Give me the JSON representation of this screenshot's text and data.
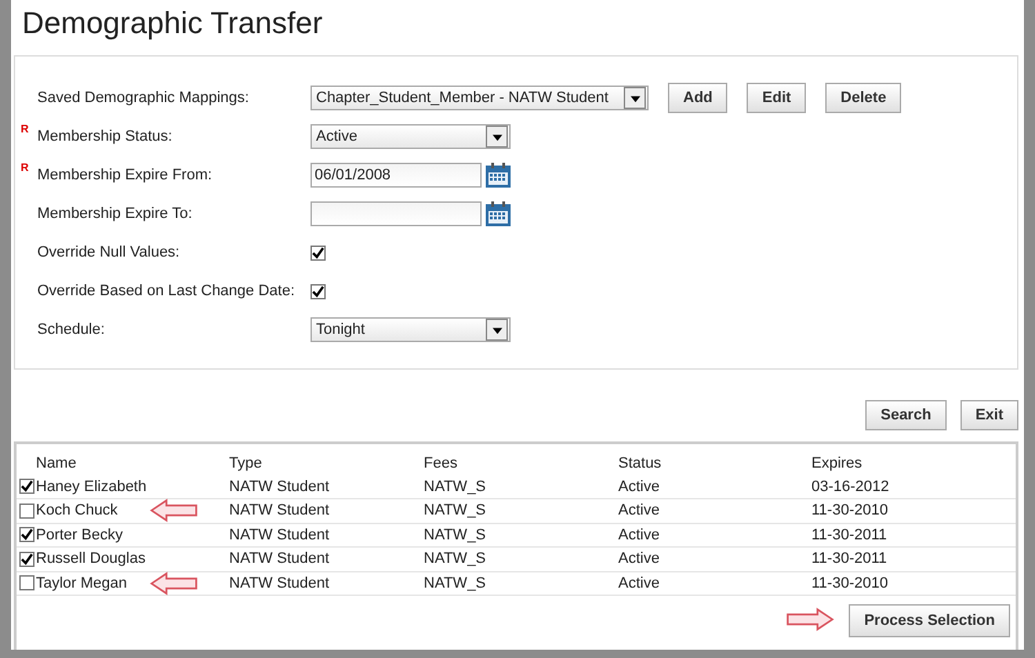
{
  "window": {
    "title": "Demographic Transfer"
  },
  "form": {
    "fields": [
      {
        "kind": "select",
        "label": "Saved Demographic Mappings:",
        "value": "Chapter_Student_Member - NATW Student",
        "buttons": [
          "Add",
          "Edit",
          "Delete"
        ]
      },
      {
        "kind": "select",
        "label": "Membership Status:",
        "required_mark": "R",
        "value": "Active"
      },
      {
        "kind": "date",
        "label": "Membership Expire From:",
        "required_mark": "R",
        "value": "06/01/2008"
      },
      {
        "kind": "date",
        "label": "Membership Expire To:"
      },
      {
        "kind": "checkbox",
        "label": "Override Null Values:",
        "checked": true
      },
      {
        "kind": "checkbox",
        "label": "Override Based on Last Change Date:",
        "checked": true
      },
      {
        "kind": "select",
        "label": "Schedule:",
        "value": "Tonight"
      }
    ]
  },
  "actions": [
    "Search",
    "Exit"
  ],
  "table": {
    "columns": [
      "Name",
      "Type",
      "Fees",
      "Status",
      "Expires"
    ],
    "rows": [
      {
        "checked": true,
        "annotated": false,
        "cells": [
          "Haney Elizabeth",
          "NATW Student",
          "NATW_S",
          "Active",
          "03-16-2012"
        ]
      },
      {
        "checked": false,
        "annotated": true,
        "cells": [
          "Koch Chuck",
          "NATW Student",
          "NATW_S",
          "Active",
          "11-30-2010"
        ]
      },
      {
        "checked": true,
        "annotated": false,
        "cells": [
          "Porter Becky",
          "NATW Student",
          "NATW_S",
          "Active",
          "11-30-2011"
        ]
      },
      {
        "checked": true,
        "annotated": false,
        "cells": [
          "Russell Douglas",
          "NATW Student",
          "NATW_S",
          "Active",
          "11-30-2011"
        ]
      },
      {
        "checked": false,
        "annotated": true,
        "cells": [
          "Taylor Megan",
          "NATW Student",
          "NATW_S",
          "Active",
          "11-30-2010"
        ]
      }
    ]
  },
  "process_button": {
    "label": "Process Selection",
    "annotated": true
  }
}
